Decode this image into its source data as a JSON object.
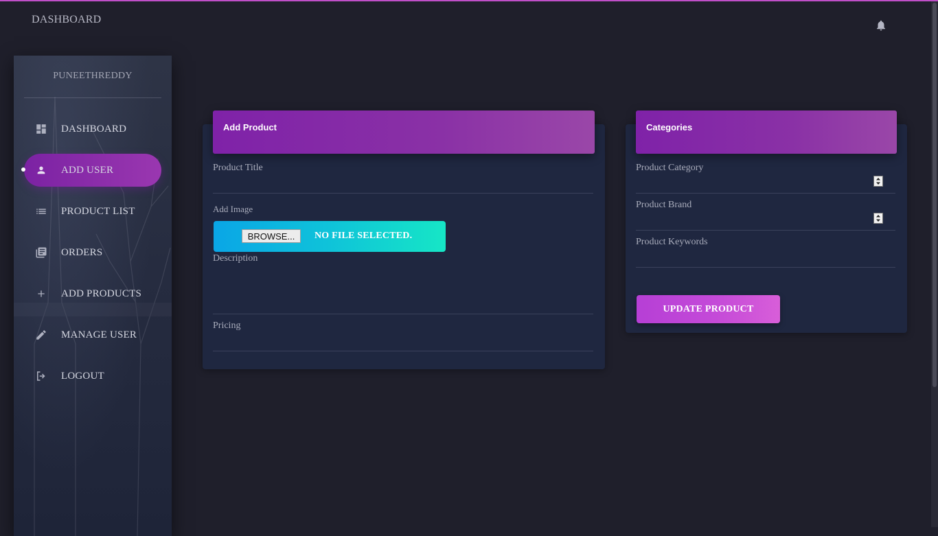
{
  "navbar": {
    "brand": "DASHBOARD",
    "notification_icon": "bell-icon"
  },
  "sidebar": {
    "username": "PUNEETHREDDY",
    "items": [
      {
        "label": "DASHBOARD",
        "icon": "dashboard-icon",
        "active": false
      },
      {
        "label": "ADD USER",
        "icon": "person-icon",
        "active": true
      },
      {
        "label": "PRODUCT LIST",
        "icon": "list-icon",
        "active": false
      },
      {
        "label": "ORDERS",
        "icon": "library-books-icon",
        "active": false
      },
      {
        "label": "ADD PRODUCTS",
        "icon": "plus-icon",
        "active": false
      },
      {
        "label": "MANAGE USER",
        "icon": "pencil-icon",
        "active": false
      },
      {
        "label": "LOGOUT",
        "icon": "logout-icon",
        "active": false
      }
    ]
  },
  "add_product": {
    "title": "Add Product",
    "product_title_label": "Product Title",
    "add_image_label": "Add Image",
    "browse_label": "BROWSE...",
    "file_status": "NO FILE SELECTED.",
    "description_label": "Description",
    "pricing_label": "Pricing"
  },
  "categories": {
    "title": "Categories",
    "product_category_label": "Product Category",
    "product_brand_label": "Product Brand",
    "product_keywords_label": "Product Keywords",
    "update_button": "UPDATE PRODUCT"
  },
  "colors": {
    "accent_purple": "#7f22a8",
    "button_pink": "#c44ad8",
    "file_gradient_start": "#0aa6e6",
    "file_gradient_end": "#16e6c6",
    "background": "#1f1f2b",
    "card_background": "#1f2740"
  }
}
